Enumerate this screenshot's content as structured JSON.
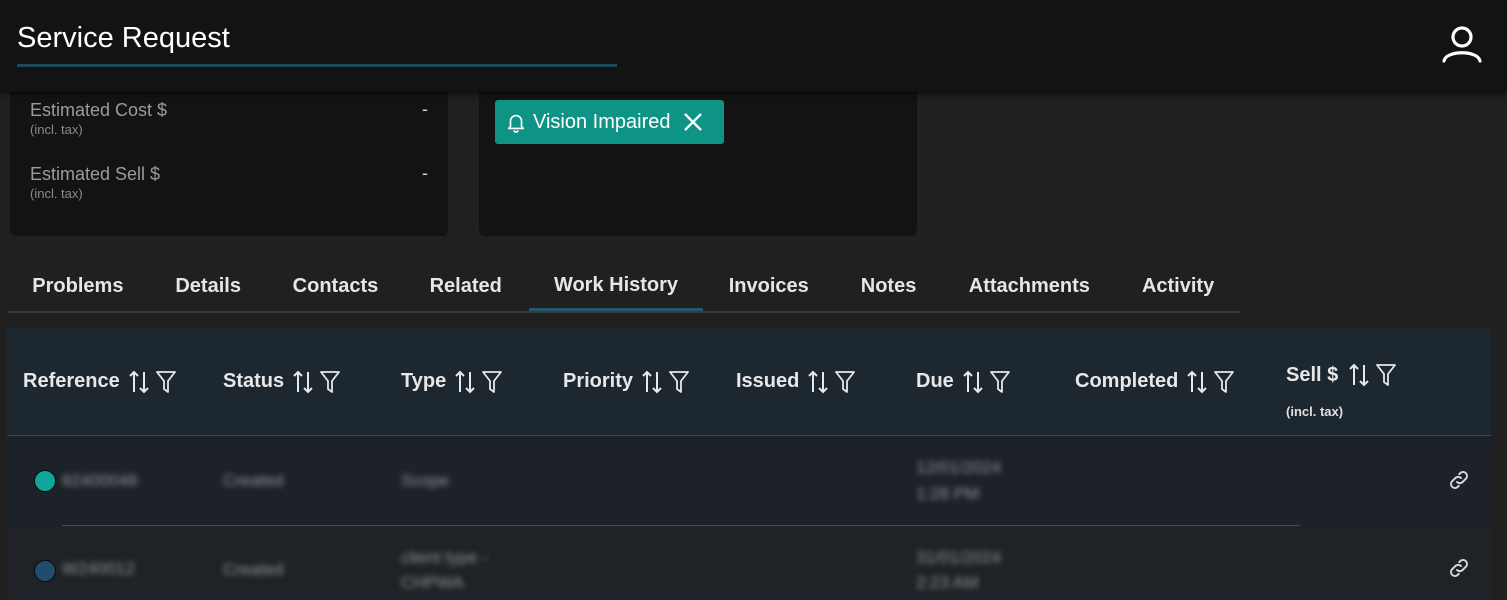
{
  "header": {
    "title": "Service Request"
  },
  "summary": {
    "estimated_cost": {
      "label": "Estimated Cost $",
      "sub": "(incl. tax)",
      "value": "-"
    },
    "estimated_sell": {
      "label": "Estimated Sell $",
      "sub": "(incl. tax)",
      "value": "-"
    }
  },
  "alerts": {
    "chip_label": "Vision Impaired",
    "chip_color": "#0e9484"
  },
  "tabs": [
    {
      "label": "Problems"
    },
    {
      "label": "Details"
    },
    {
      "label": "Contacts"
    },
    {
      "label": "Related"
    },
    {
      "label": "Work History"
    },
    {
      "label": "Invoices"
    },
    {
      "label": "Notes"
    },
    {
      "label": "Attachments"
    },
    {
      "label": "Activity"
    }
  ],
  "active_tab": "Work History",
  "table": {
    "columns": [
      {
        "label": "Reference"
      },
      {
        "label": "Status"
      },
      {
        "label": "Type"
      },
      {
        "label": "Priority"
      },
      {
        "label": "Issued"
      },
      {
        "label": "Due"
      },
      {
        "label": "Completed"
      },
      {
        "label": "Sell $",
        "sub": "(incl. tax)"
      }
    ],
    "rows": [
      {
        "status_color": "#10a79a",
        "reference": "82400048",
        "status": "Created",
        "type": "Scope",
        "due_date": "12/01/2024",
        "due_time": "1:28 PM"
      },
      {
        "status_color": "#1f4d6b",
        "reference": "W240012",
        "status": "Created",
        "type_line1": "client type -",
        "type_line2": "CHPWA",
        "due_date": "31/01/2024",
        "due_time": "2:23 AM"
      }
    ]
  }
}
